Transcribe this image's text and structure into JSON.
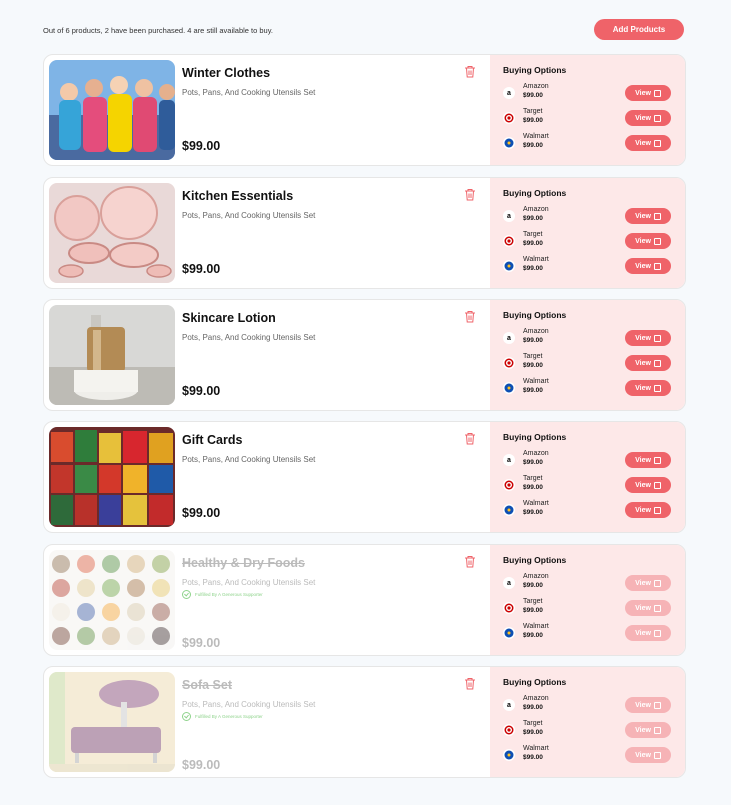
{
  "header": {
    "summary": "Out of 6 products, 2 have been purchased. 4 are still available to buy.",
    "add_button": "Add Products"
  },
  "buying_options_label": "Buying Options",
  "view_label": "View",
  "fulfilled_label": "Fulfilled By A Generous Supporter",
  "stores": [
    {
      "name": "Amazon",
      "price": "$99.00",
      "icon": "amazon-icon"
    },
    {
      "name": "Target",
      "price": "$99.00",
      "icon": "target-icon"
    },
    {
      "name": "Walmart",
      "price": "$99.00",
      "icon": "walmart-icon"
    }
  ],
  "products": [
    {
      "title": "Winter Clothes",
      "subtitle": "Pots, Pans, And Cooking Utensils Set",
      "price": "$99.00",
      "purchased": false
    },
    {
      "title": "Kitchen Essentials",
      "subtitle": "Pots, Pans, And Cooking Utensils Set",
      "price": "$99.00",
      "purchased": false
    },
    {
      "title": "Skincare Lotion",
      "subtitle": "Pots, Pans, And Cooking Utensils Set",
      "price": "$99.00",
      "purchased": false
    },
    {
      "title": "Gift Cards",
      "subtitle": "Pots, Pans, And Cooking Utensils Set",
      "price": "$99.00",
      "purchased": false
    },
    {
      "title": "Healthy & Dry Foods",
      "subtitle": "Pots, Pans, And Cooking Utensils Set",
      "price": "$99.00",
      "purchased": true
    },
    {
      "title": "Sofa Set",
      "subtitle": "Pots, Pans, And Cooking Utensils Set",
      "price": "$99.00",
      "purchased": true
    }
  ],
  "colors": {
    "accent": "#ef6369",
    "panel": "#fde8e8"
  }
}
